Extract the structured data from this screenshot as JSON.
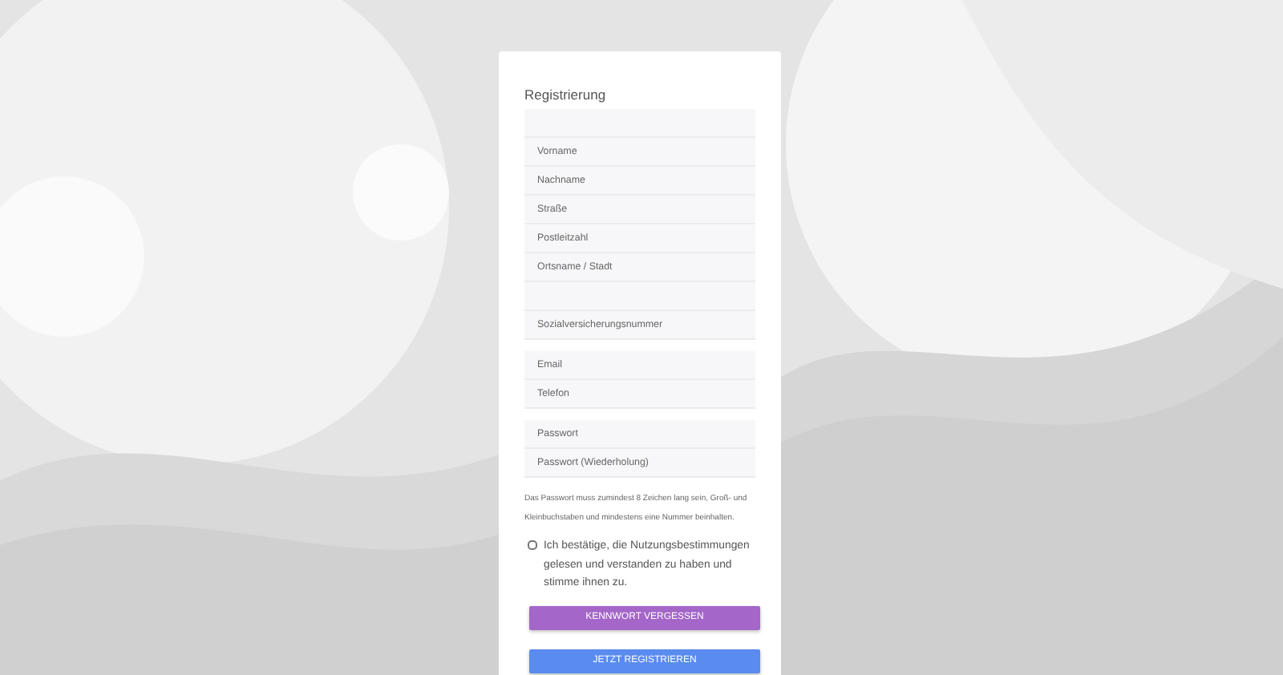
{
  "title": "Registrierung",
  "field_groups": [
    {
      "fields": [
        {
          "kind": "blank"
        },
        {
          "kind": "text",
          "placeholder": "Vorname"
        },
        {
          "kind": "text",
          "placeholder": "Nachname"
        },
        {
          "kind": "text",
          "placeholder": "Straße"
        },
        {
          "kind": "text",
          "placeholder": "Postleitzahl"
        },
        {
          "kind": "text",
          "placeholder": "Ortsname / Stadt"
        },
        {
          "kind": "blank"
        },
        {
          "kind": "text",
          "placeholder": "Sozialversicherungsnummer"
        }
      ]
    },
    {
      "fields": [
        {
          "kind": "text",
          "placeholder": "Email"
        },
        {
          "kind": "text",
          "placeholder": "Telefon"
        }
      ]
    },
    {
      "fields": [
        {
          "kind": "password",
          "placeholder": "Passwort"
        },
        {
          "kind": "password",
          "placeholder": "Passwort (Wiederholung)"
        }
      ]
    }
  ],
  "hint": "Das Passwort muss zumindest 8 Zeichen lang sein, Groß- und Kleinbuchstaben und mindestens eine Nummer beinhalten.",
  "terms": {
    "checked": false,
    "label": "Ich bestätige, die Nutzungsbestimmungen gelesen und verstanden zu haben und stimme ihnen zu."
  },
  "buttons": [
    {
      "kind": "secondary",
      "label": "KENNWORT VERGESSEN"
    },
    {
      "kind": "primary",
      "label": "JETZT REGISTRIEREN"
    }
  ]
}
